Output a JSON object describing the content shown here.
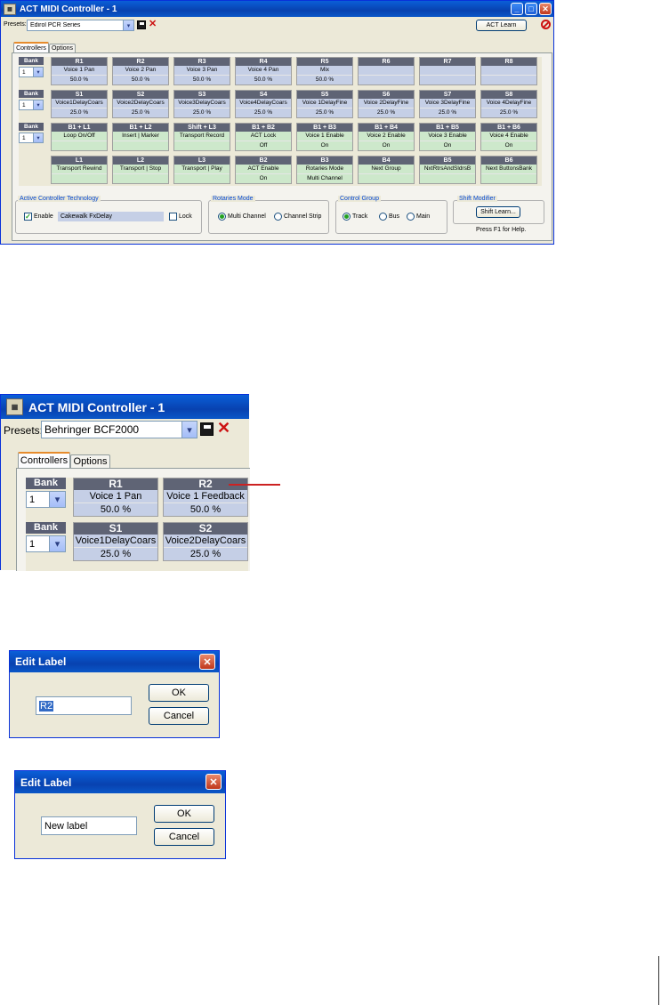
{
  "top_window": {
    "title": "ACT MIDI Controller - 1",
    "presets_label": "Presets:",
    "preset_value": "Edirol PCR Series",
    "act_learn_label": "ACT Learn",
    "tabs": [
      "Controllers",
      "Options"
    ],
    "bank_label": "Bank",
    "bank_value": "1",
    "rows": [
      [
        {
          "h": "R1",
          "n": "Voice 1 Pan",
          "v": "50.0 %"
        },
        {
          "h": "R2",
          "n": "Voice 2 Pan",
          "v": "50.0 %"
        },
        {
          "h": "R3",
          "n": "Voice 3 Pan",
          "v": "50.0 %"
        },
        {
          "h": "R4",
          "n": "Voice 4 Pan",
          "v": "50.0 %"
        },
        {
          "h": "R5",
          "n": "Mix",
          "v": "50.0 %"
        },
        {
          "h": "R6",
          "n": "",
          "v": ""
        },
        {
          "h": "R7",
          "n": "",
          "v": ""
        },
        {
          "h": "R8",
          "n": "",
          "v": ""
        }
      ],
      [
        {
          "h": "S1",
          "n": "Voice1DelayCoars",
          "v": "25.0 %"
        },
        {
          "h": "S2",
          "n": "Voice2DelayCoars",
          "v": "25.0 %"
        },
        {
          "h": "S3",
          "n": "Voice3DelayCoars",
          "v": "25.0 %"
        },
        {
          "h": "S4",
          "n": "Voice4DelayCoars",
          "v": "25.0 %"
        },
        {
          "h": "S5",
          "n": "Voice 1DelayFine",
          "v": "25.0 %"
        },
        {
          "h": "S6",
          "n": "Voice 2DelayFine",
          "v": "25.0 %"
        },
        {
          "h": "S7",
          "n": "Voice 3DelayFine",
          "v": "25.0 %"
        },
        {
          "h": "S8",
          "n": "Voice 4DelayFine",
          "v": "25.0 %"
        }
      ],
      [
        {
          "h": "B1 + L1",
          "n": "Loop On/Off",
          "v": ""
        },
        {
          "h": "B1 + L2",
          "n": "Insert | Marker",
          "v": ""
        },
        {
          "h": "Shift + L3",
          "n": "Transport Record",
          "v": ""
        },
        {
          "h": "B1 + B2",
          "n": "ACT Lock",
          "v": "Off"
        },
        {
          "h": "B1 + B3",
          "n": "Voice 1 Enable",
          "v": "On"
        },
        {
          "h": "B1 + B4",
          "n": "Voice 2 Enable",
          "v": "On"
        },
        {
          "h": "B1 + B5",
          "n": "Voice 3 Enable",
          "v": "On"
        },
        {
          "h": "B1 + B6",
          "n": "Voice 4 Enable",
          "v": "On"
        }
      ],
      [
        {
          "h": "L1",
          "n": "Transport Rewind",
          "v": ""
        },
        {
          "h": "L2",
          "n": "Transport | Stop",
          "v": ""
        },
        {
          "h": "L3",
          "n": "Transport | Play",
          "v": ""
        },
        {
          "h": "B2",
          "n": "ACT Enable",
          "v": "On"
        },
        {
          "h": "B3",
          "n": "Rotaries Mode",
          "v": "Multi Channel"
        },
        {
          "h": "B4",
          "n": "Next Group",
          "v": ""
        },
        {
          "h": "B5",
          "n": "NxtRtrsAndSldrsB",
          "v": ""
        },
        {
          "h": "B6",
          "n": "Next ButtonsBank",
          "v": ""
        }
      ]
    ],
    "act_group": {
      "title": "Active Controller Technology",
      "enable_label": "Enable",
      "plugin": "Cakewalk FxDelay",
      "lock_label": "Lock"
    },
    "rot_group": {
      "title": "Rotaries Mode",
      "opt1": "Multi Channel",
      "opt2": "Channel Strip"
    },
    "cg_group": {
      "title": "Control Group",
      "opt1": "Track",
      "opt2": "Bus",
      "opt3": "Main"
    },
    "shift_group": {
      "title": "Shift Modifier",
      "button": "Shift Learn..."
    },
    "help_text": "Press F1 for Help."
  },
  "zoom_window": {
    "title": "ACT MIDI Controller - 1",
    "presets_label": "Presets:",
    "preset_value": "Behringer BCF2000",
    "tabs": [
      "Controllers",
      "Options"
    ],
    "bank_label": "Bank",
    "bank_value": "1",
    "rows": [
      [
        {
          "h": "R1",
          "n": "Voice 1 Pan",
          "v": "50.0 %"
        },
        {
          "h": "R2",
          "n": "Voice 1 Feedback",
          "v": "50.0 %"
        }
      ],
      [
        {
          "h": "S1",
          "n": "Voice1DelayCoars",
          "v": "25.0 %"
        },
        {
          "h": "S2",
          "n": "Voice2DelayCoars",
          "v": "25.0 %"
        }
      ]
    ]
  },
  "dialog1": {
    "title": "Edit Label",
    "value": "R2",
    "ok": "OK",
    "cancel": "Cancel"
  },
  "dialog2": {
    "title": "Edit Label",
    "value": "New label",
    "ok": "OK",
    "cancel": "Cancel"
  },
  "colors": {
    "accent_arrow": "#cc2222",
    "title_blue": "#0842b0"
  }
}
